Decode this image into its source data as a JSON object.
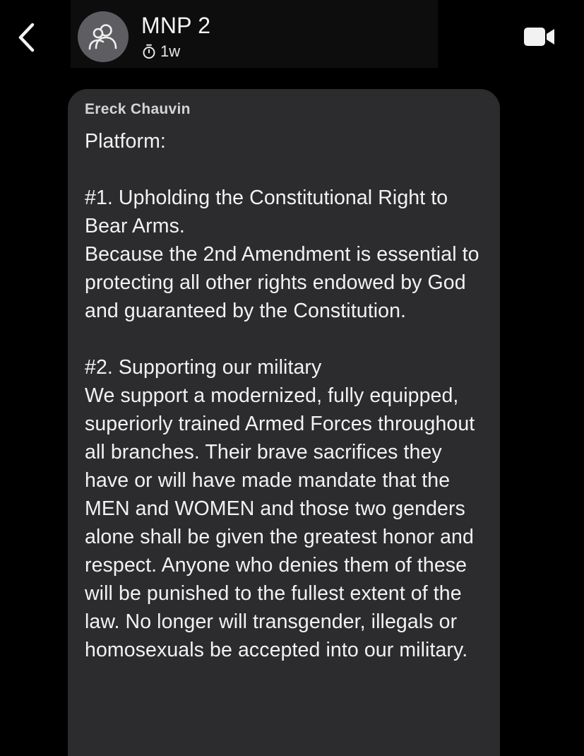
{
  "header": {
    "title": "MNP 2",
    "timer": "1w",
    "back_icon": "chevron-left-icon",
    "avatar_icon": "group-icon",
    "video_icon": "video-camera-icon"
  },
  "message": {
    "sender": "Ereck Chauvin",
    "text": "Platform:\n\n#1. Upholding the Constitutional Right to Bear Arms.\nBecause the 2nd Amendment is essential to protecting all other rights endowed by God and guaranteed by the Constitution.\n\n#2. Supporting our military\nWe support a modernized, fully equipped, superiorly trained Armed Forces throughout all branches. Their brave sacrifices they have or will have made mandate that the MEN and WOMEN and those two genders alone shall be given the greatest honor and respect. Anyone who denies them of these will be punished to the fullest extent of the law. No longer will transgender, illegals or homosexuals be accepted into our military."
  },
  "colors": {
    "background": "#000000",
    "bubble": "#2c2c2e",
    "avatar": "#5e5e62",
    "text": "#f2f2f2",
    "sender": "#d4d4d6"
  }
}
